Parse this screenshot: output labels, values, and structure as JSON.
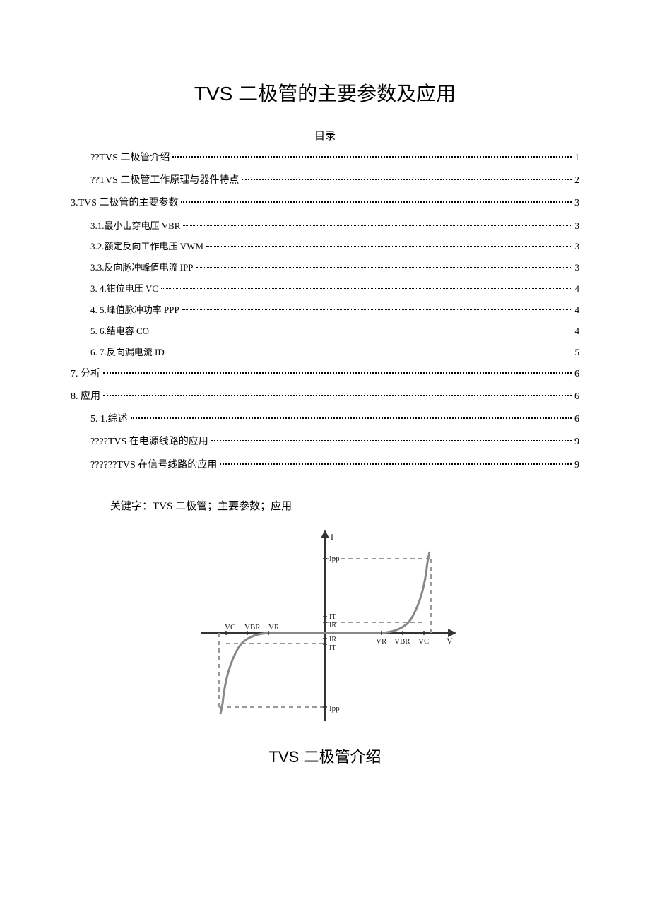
{
  "title": "TVS 二极管的主要参数及应用",
  "toc_caption": "目录",
  "toc": [
    {
      "label": "??TVS 二极管介绍",
      "page": "1",
      "indent": 1,
      "sub": false
    },
    {
      "label": "??TVS 二极管工作原理与器件特点",
      "page": "2",
      "indent": 1,
      "sub": false
    },
    {
      "label": "3.TVS 二极管的主要参数",
      "page": "3",
      "indent": 0,
      "sub": false
    },
    {
      "label": "3.1.最小击穿电压 VBR",
      "page": "3",
      "indent": 1,
      "sub": true
    },
    {
      "label": "3.2.额定反向工作电压 VWM",
      "page": "3",
      "indent": 1,
      "sub": true
    },
    {
      "label": "3.3.反向脉冲峰值电流 IPP",
      "page": "3",
      "indent": 1,
      "sub": true
    },
    {
      "label": "3.   4.钳位电压 VC",
      "page": "4",
      "indent": 1,
      "sub": true
    },
    {
      "label": "4.   5.峰值脉冲功率 PPP",
      "page": "4",
      "indent": 1,
      "sub": true
    },
    {
      "label": "5.   6.结电容 CO",
      "page": "4",
      "indent": 1,
      "sub": true
    },
    {
      "label": "6.   7.反向漏电流 ID",
      "page": "5",
      "indent": 1,
      "sub": true
    },
    {
      "label": "7.   分析",
      "page": "6",
      "indent": 0,
      "sub": false
    },
    {
      "label": "8.   应用",
      "page": "6",
      "indent": 0,
      "sub": false
    },
    {
      "label": "5.   1.综述",
      "page": "6",
      "indent": 1,
      "sub": false
    },
    {
      "label": "????TVS 在电源线路的应用",
      "page": "9",
      "indent": 1,
      "sub": false
    },
    {
      "label": "??????TVS 在信号线路的应用",
      "page": "9",
      "indent": 1,
      "sub": false
    }
  ],
  "keywords_label": "关键字：TVS 二极管；主要参数；应用",
  "section_heading": "TVS 二极管介绍",
  "diagram": {
    "y_axis": "I",
    "x_axis": "V",
    "pos_x_ticks": [
      "VR",
      "VBR",
      "VC"
    ],
    "neg_x_ticks": [
      "VC",
      "VBR",
      "VR"
    ],
    "y_top": "Ipp",
    "y_bottom": "Ipp",
    "y_small_top": [
      "IT",
      "IR"
    ],
    "y_small_bot": [
      "IR",
      "IT"
    ]
  }
}
